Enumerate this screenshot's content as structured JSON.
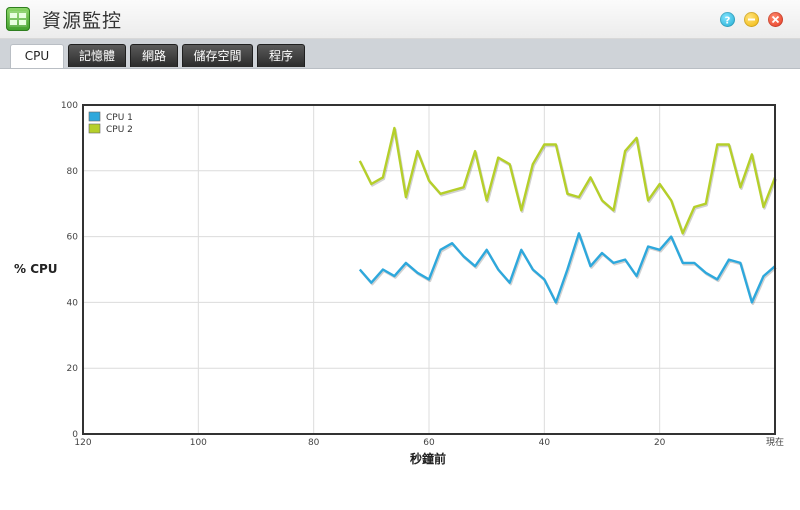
{
  "window": {
    "title": "資源監控"
  },
  "tabs": [
    {
      "label": "CPU",
      "active": true
    },
    {
      "label": "記憶體",
      "active": false
    },
    {
      "label": "網路",
      "active": false
    },
    {
      "label": "儲存空間",
      "active": false
    },
    {
      "label": "程序",
      "active": false
    }
  ],
  "colors": {
    "cpu1": "#2ea8dc",
    "cpu2": "#b5cf2a",
    "app_icon": "#4caf32"
  },
  "chart_data": {
    "type": "line",
    "ylabel": "% CPU",
    "xlabel": "秒鐘前",
    "xlim": [
      120,
      0
    ],
    "ylim": [
      0,
      100
    ],
    "xticks": [
      {
        "value": 120,
        "label": "120"
      },
      {
        "value": 100,
        "label": "100"
      },
      {
        "value": 80,
        "label": "80"
      },
      {
        "value": 60,
        "label": "60"
      },
      {
        "value": 40,
        "label": "40"
      },
      {
        "value": 20,
        "label": "20"
      },
      {
        "value": 0,
        "label": "現在"
      }
    ],
    "yticks": [
      0,
      20,
      40,
      60,
      80,
      100
    ],
    "grid": true,
    "legend": "top-left",
    "x": [
      72,
      70,
      68,
      66,
      64,
      62,
      60,
      58,
      56,
      54,
      52,
      50,
      48,
      46,
      44,
      42,
      40,
      38,
      36,
      34,
      32,
      30,
      28,
      26,
      24,
      22,
      20,
      18,
      16,
      14,
      12,
      10,
      8,
      6,
      4,
      2,
      0
    ],
    "series": [
      {
        "name": "CPU 1",
        "color": "#2ea8dc",
        "values": [
          50,
          46,
          50,
          48,
          52,
          49,
          47,
          56,
          58,
          54,
          51,
          56,
          50,
          46,
          56,
          50,
          47,
          40,
          50,
          61,
          51,
          55,
          52,
          53,
          48,
          57,
          56,
          60,
          52,
          52,
          49,
          47,
          53,
          52,
          40,
          48,
          51
        ]
      },
      {
        "name": "CPU 2",
        "color": "#b5cf2a",
        "values": [
          83,
          76,
          78,
          93,
          72,
          86,
          77,
          73,
          74,
          75,
          86,
          71,
          84,
          82,
          68,
          82,
          88,
          88,
          73,
          72,
          78,
          71,
          68,
          86,
          90,
          71,
          76,
          71,
          61,
          69,
          70,
          88,
          88,
          75,
          85,
          69,
          78
        ]
      }
    ]
  }
}
